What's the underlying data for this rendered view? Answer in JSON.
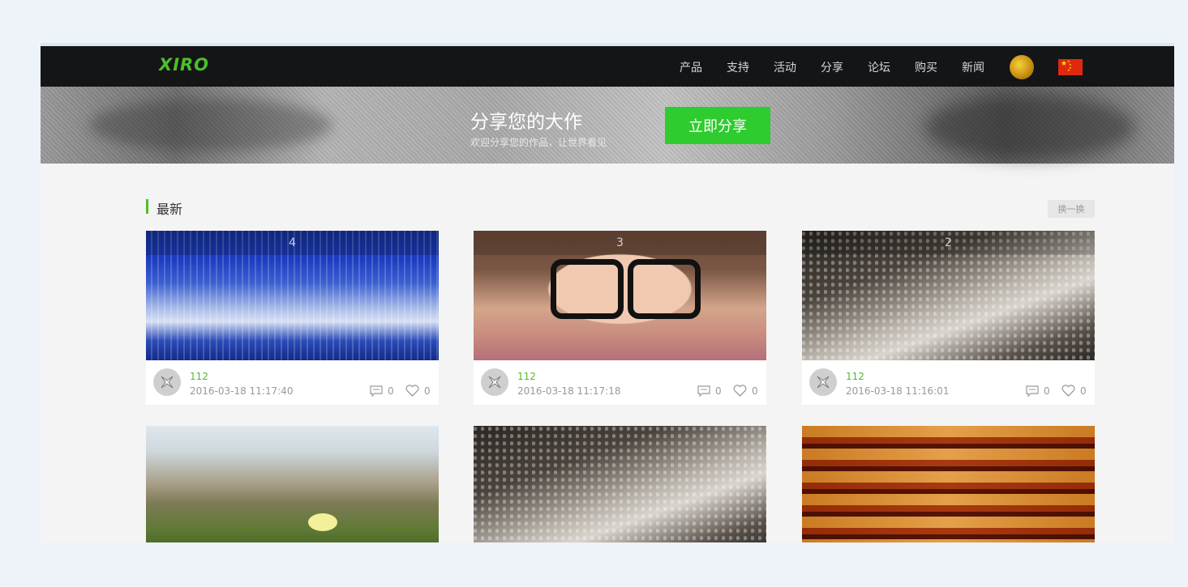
{
  "header": {
    "logo": "XIRO",
    "nav": [
      {
        "label": "产品"
      },
      {
        "label": "支持"
      },
      {
        "label": "活动"
      },
      {
        "label": "分享"
      },
      {
        "label": "论坛"
      },
      {
        "label": "购买"
      },
      {
        "label": "新闻"
      }
    ],
    "avatar_icon": "user-avatar",
    "language_icon": "china-flag"
  },
  "banner": {
    "title": "分享您的大作",
    "subtitle": "欢迎分享您的作品，让世界看见",
    "share_button": "立即分享"
  },
  "section": {
    "title": "最新",
    "refresh_label": "换一换"
  },
  "cards": [
    {
      "number": "4",
      "username": "112",
      "time": "2016-03-18 11:17:40",
      "comments": "0",
      "likes": "0",
      "image": "snowy-forest"
    },
    {
      "number": "3",
      "username": "112",
      "time": "2016-03-18 11:17:18",
      "comments": "0",
      "likes": "0",
      "image": "girl-with-glasses"
    },
    {
      "number": "2",
      "username": "112",
      "time": "2016-03-18 11:16:01",
      "comments": "0",
      "likes": "0",
      "image": "glamour-portrait"
    },
    {
      "image": "grass-dunes"
    },
    {
      "image": "glamour-portrait"
    },
    {
      "image": "orange-stairs"
    }
  ]
}
